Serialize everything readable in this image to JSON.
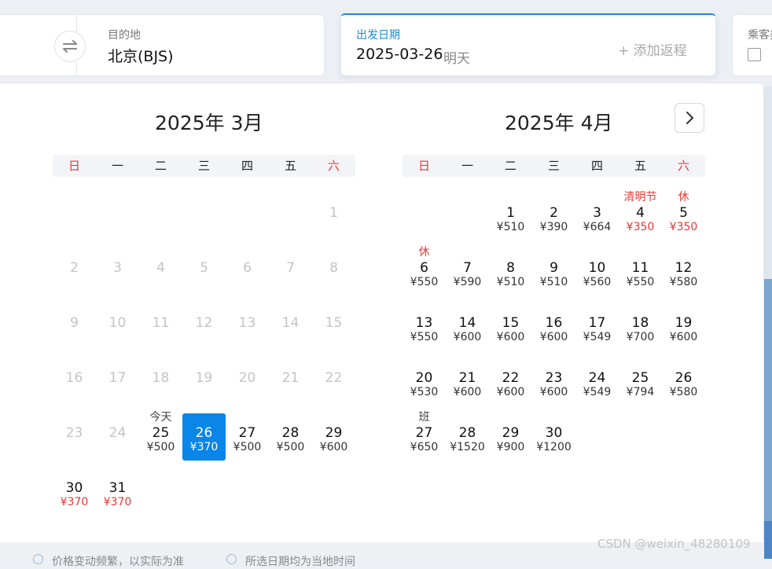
{
  "search": {
    "destination_label": "目的地",
    "destination_value": "北京(BJS)",
    "date_label": "出发日期",
    "date_value": "2025-03-26",
    "date_sub": "明天",
    "add_return_label": "+ 添加返程",
    "passenger_label": "乘客类型"
  },
  "colors": {
    "accent": "#0a85e8",
    "holiday_red": "#e53935",
    "disabled": "#c4c4c4"
  },
  "calendar": {
    "weekdays": [
      "日",
      "一",
      "二",
      "三",
      "四",
      "五",
      "六"
    ],
    "months": [
      {
        "title": "2025年 3月",
        "days": [
          {
            "day": "1",
            "row": 0,
            "col": 6,
            "disabled": true
          },
          {
            "day": "2",
            "row": 1,
            "col": 0,
            "disabled": true
          },
          {
            "day": "3",
            "row": 1,
            "col": 1,
            "disabled": true
          },
          {
            "day": "4",
            "row": 1,
            "col": 2,
            "disabled": true
          },
          {
            "day": "5",
            "row": 1,
            "col": 3,
            "disabled": true
          },
          {
            "day": "6",
            "row": 1,
            "col": 4,
            "disabled": true
          },
          {
            "day": "7",
            "row": 1,
            "col": 5,
            "disabled": true
          },
          {
            "day": "8",
            "row": 1,
            "col": 6,
            "disabled": true
          },
          {
            "day": "9",
            "row": 2,
            "col": 0,
            "disabled": true
          },
          {
            "day": "10",
            "row": 2,
            "col": 1,
            "disabled": true
          },
          {
            "day": "11",
            "row": 2,
            "col": 2,
            "disabled": true
          },
          {
            "day": "12",
            "row": 2,
            "col": 3,
            "disabled": true
          },
          {
            "day": "13",
            "row": 2,
            "col": 4,
            "disabled": true
          },
          {
            "day": "14",
            "row": 2,
            "col": 5,
            "disabled": true
          },
          {
            "day": "15",
            "row": 2,
            "col": 6,
            "disabled": true
          },
          {
            "day": "16",
            "row": 3,
            "col": 0,
            "disabled": true
          },
          {
            "day": "17",
            "row": 3,
            "col": 1,
            "disabled": true
          },
          {
            "day": "18",
            "row": 3,
            "col": 2,
            "disabled": true
          },
          {
            "day": "19",
            "row": 3,
            "col": 3,
            "disabled": true
          },
          {
            "day": "20",
            "row": 3,
            "col": 4,
            "disabled": true
          },
          {
            "day": "21",
            "row": 3,
            "col": 5,
            "disabled": true
          },
          {
            "day": "22",
            "row": 3,
            "col": 6,
            "disabled": true
          },
          {
            "day": "23",
            "row": 4,
            "col": 0,
            "disabled": true
          },
          {
            "day": "24",
            "row": 4,
            "col": 1,
            "disabled": true
          },
          {
            "day": "25",
            "row": 4,
            "col": 2,
            "price": "¥500",
            "tag": "今天",
            "tag_color": "gray"
          },
          {
            "day": "26",
            "row": 4,
            "col": 3,
            "price": "¥370",
            "selected": true
          },
          {
            "day": "27",
            "row": 4,
            "col": 4,
            "price": "¥500"
          },
          {
            "day": "28",
            "row": 4,
            "col": 5,
            "price": "¥500"
          },
          {
            "day": "29",
            "row": 4,
            "col": 6,
            "price": "¥600"
          },
          {
            "day": "30",
            "row": 5,
            "col": 0,
            "price": "¥370",
            "price_red": true
          },
          {
            "day": "31",
            "row": 5,
            "col": 1,
            "price": "¥370",
            "price_red": true
          }
        ]
      },
      {
        "title": "2025年 4月",
        "days": [
          {
            "day": "1",
            "row": 0,
            "col": 2,
            "price": "¥510"
          },
          {
            "day": "2",
            "row": 0,
            "col": 3,
            "price": "¥390"
          },
          {
            "day": "3",
            "row": 0,
            "col": 4,
            "price": "¥664"
          },
          {
            "day": "4",
            "row": 0,
            "col": 5,
            "price": "¥350",
            "price_red": true,
            "tag": "清明节",
            "tag_color": "red"
          },
          {
            "day": "5",
            "row": 0,
            "col": 6,
            "price": "¥350",
            "price_red": true,
            "tag": "休",
            "tag_color": "red"
          },
          {
            "day": "6",
            "row": 1,
            "col": 0,
            "price": "¥550",
            "tag": "休",
            "tag_color": "red"
          },
          {
            "day": "7",
            "row": 1,
            "col": 1,
            "price": "¥590"
          },
          {
            "day": "8",
            "row": 1,
            "col": 2,
            "price": "¥510"
          },
          {
            "day": "9",
            "row": 1,
            "col": 3,
            "price": "¥510"
          },
          {
            "day": "10",
            "row": 1,
            "col": 4,
            "price": "¥560"
          },
          {
            "day": "11",
            "row": 1,
            "col": 5,
            "price": "¥550"
          },
          {
            "day": "12",
            "row": 1,
            "col": 6,
            "price": "¥580"
          },
          {
            "day": "13",
            "row": 2,
            "col": 0,
            "price": "¥550"
          },
          {
            "day": "14",
            "row": 2,
            "col": 1,
            "price": "¥600"
          },
          {
            "day": "15",
            "row": 2,
            "col": 2,
            "price": "¥600"
          },
          {
            "day": "16",
            "row": 2,
            "col": 3,
            "price": "¥600"
          },
          {
            "day": "17",
            "row": 2,
            "col": 4,
            "price": "¥549"
          },
          {
            "day": "18",
            "row": 2,
            "col": 5,
            "price": "¥700"
          },
          {
            "day": "19",
            "row": 2,
            "col": 6,
            "price": "¥600"
          },
          {
            "day": "20",
            "row": 3,
            "col": 0,
            "price": "¥530"
          },
          {
            "day": "21",
            "row": 3,
            "col": 1,
            "price": "¥600"
          },
          {
            "day": "22",
            "row": 3,
            "col": 2,
            "price": "¥600"
          },
          {
            "day": "23",
            "row": 3,
            "col": 3,
            "price": "¥600"
          },
          {
            "day": "24",
            "row": 3,
            "col": 4,
            "price": "¥549"
          },
          {
            "day": "25",
            "row": 3,
            "col": 5,
            "price": "¥794"
          },
          {
            "day": "26",
            "row": 3,
            "col": 6,
            "price": "¥580"
          },
          {
            "day": "27",
            "row": 4,
            "col": 0,
            "price": "¥650",
            "tag": "班",
            "tag_color": "gray"
          },
          {
            "day": "28",
            "row": 4,
            "col": 1,
            "price": "¥1520"
          },
          {
            "day": "29",
            "row": 4,
            "col": 2,
            "price": "¥900"
          },
          {
            "day": "30",
            "row": 4,
            "col": 3,
            "price": "¥1200"
          }
        ]
      }
    ]
  },
  "footer": {
    "note1": "价格变动频繁，以实际为准",
    "note2": "所选日期均为当地时间"
  },
  "watermark": "CSDN @weixin_48280109"
}
